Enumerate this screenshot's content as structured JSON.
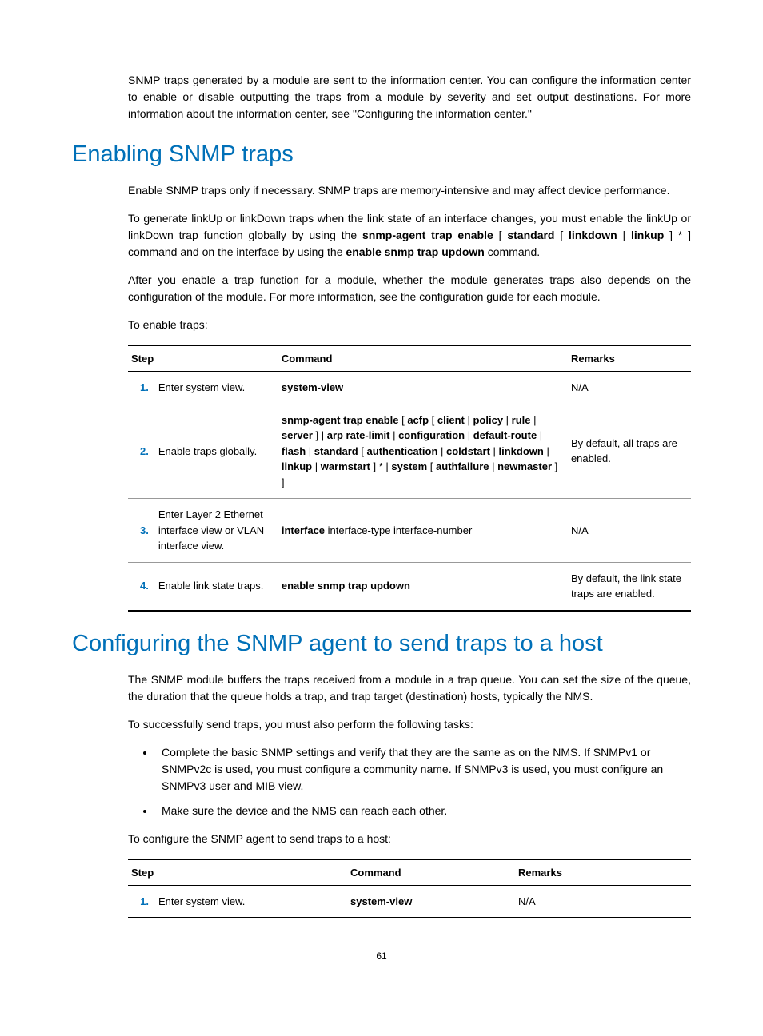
{
  "intro_para": "SNMP traps generated by a module are sent to the information center. You can configure the information center to enable or disable outputting the traps from a module by severity and set output destinations. For more information about the information center, see \"Configuring the information center.\"",
  "section1": {
    "heading": "Enabling SNMP traps",
    "p1": "Enable SNMP traps only if necessary. SNMP traps are memory-intensive and may affect device performance.",
    "p2_a": "To generate linkUp or linkDown traps when the link state of an interface changes, you must enable the linkUp or linkDown trap function globally by using the ",
    "p2_b1": "snmp-agent trap enable",
    "p2_b2": " [ ",
    "p2_b3": "standard",
    "p2_b4": " [ ",
    "p2_b5": "linkdown",
    "p2_b6": " | ",
    "p2_b7": "linkup",
    "p2_b8": " ] * ] command and on the interface by using the ",
    "p2_b9": "enable snmp trap updown",
    "p2_b10": " command.",
    "p3": "After you enable a trap function for a module, whether the module generates traps also depends on the configuration of the module. For more information, see the configuration guide for each module.",
    "p4": "To enable traps:"
  },
  "table1": {
    "h_step": "Step",
    "h_cmd": "Command",
    "h_rem": "Remarks",
    "rows": [
      {
        "num": "1.",
        "step": "Enter system view.",
        "cmd_bold": "system-view",
        "rem": "N/A"
      },
      {
        "num": "2.",
        "step": "Enable traps globally.",
        "cmd_parts": {
          "b1": "snmp-agent trap enable",
          "t1": " [ ",
          "b2": "acfp",
          "t2": " [ ",
          "b3": "client",
          "t3": " | ",
          "b4": "policy",
          "t4": " | ",
          "b5": "rule",
          "t5": " | ",
          "b6": "server",
          "t6": " ] | ",
          "b7": "arp rate-limit",
          "t7": " | ",
          "b8": "configuration",
          "t8": " | ",
          "b9": "default-route",
          "t9": " | ",
          "b10": "flash",
          "t10": " | ",
          "b11": "standard",
          "t11": " [ ",
          "b12": "authentication",
          "t12": " | ",
          "b13": "coldstart",
          "t13": " | ",
          "b14": "linkdown",
          "t14": " | ",
          "b15": "linkup",
          "t15": " | ",
          "b16": "warmstart",
          "t16": " ] * | ",
          "b17": "system",
          "t17": " [ ",
          "b18": "authfailure",
          "t18": " | ",
          "b19": "newmaster",
          "t19": " ] ]"
        },
        "rem": "By default, all traps are enabled."
      },
      {
        "num": "3.",
        "step": "Enter Layer 2 Ethernet interface view or VLAN interface view.",
        "cmd_bold": "interface",
        "cmd_plain": " interface-type interface-number",
        "rem": "N/A"
      },
      {
        "num": "4.",
        "step": "Enable link state traps.",
        "cmd_bold": "enable snmp trap updown",
        "rem": "By default, the link state traps are enabled."
      }
    ]
  },
  "section2": {
    "heading": "Configuring the SNMP agent to send traps to a host",
    "p1": "The SNMP module buffers the traps received from a module in a trap queue. You can set the size of the queue, the duration that the queue holds a trap, and trap target (destination) hosts, typically the NMS.",
    "p2": "To successfully send traps, you must also perform the following tasks:",
    "bullets": [
      "Complete the basic SNMP settings and verify that they are the same as on the NMS. If SNMPv1 or SNMPv2c is used, you must configure a community name. If SNMPv3 is used, you must configure an SNMPv3 user and MIB view.",
      "Make sure the device and the NMS can reach each other."
    ],
    "p3": "To configure the SNMP agent to send traps to a host:"
  },
  "table2": {
    "h_step": "Step",
    "h_cmd": "Command",
    "h_rem": "Remarks",
    "rows": [
      {
        "num": "1.",
        "step": "Enter system view.",
        "cmd_bold": "system-view",
        "rem": "N/A"
      }
    ]
  },
  "page_number": "61"
}
